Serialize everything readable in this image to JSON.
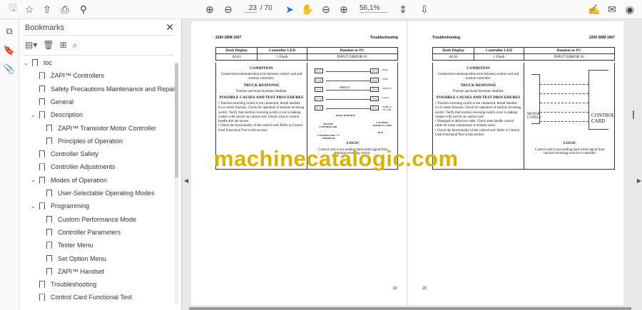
{
  "toolbar": {
    "page_current": "23",
    "page_total": "/ 70",
    "zoom": "56,1%"
  },
  "bookmarks": {
    "title": "Bookmarks",
    "items": [
      {
        "label": "toc",
        "level": 0,
        "twisty": "expanded"
      },
      {
        "label": "ZAPI™ Controllers",
        "level": 1
      },
      {
        "label": "Safety Precautions Maintenance and Repair",
        "level": 1
      },
      {
        "label": "General",
        "level": 1
      },
      {
        "label": "Description",
        "level": 1,
        "twisty": "expanded"
      },
      {
        "label": "ZAPI™ Transistor Motor Controller",
        "level": 2
      },
      {
        "label": "Principles of Operation",
        "level": 2
      },
      {
        "label": "Controller Safety",
        "level": 1
      },
      {
        "label": "Controller Adjustments",
        "level": 1
      },
      {
        "label": "Modes of Operation",
        "level": 1,
        "twisty": "expanded"
      },
      {
        "label": "User-Selectable Operating Modes",
        "level": 2
      },
      {
        "label": "Programming",
        "level": 1,
        "twisty": "expanded"
      },
      {
        "label": "Custom Performance Mode",
        "level": 2
      },
      {
        "label": "Controller Parameters",
        "level": 2
      },
      {
        "label": "Tester Menu",
        "level": 2
      },
      {
        "label": "Set Option Menu",
        "level": 2
      },
      {
        "label": "ZAPI™ Handset",
        "level": 2
      },
      {
        "label": "Troubleshooting",
        "level": 1
      },
      {
        "label": "Control Card Functional Test",
        "level": 1
      }
    ]
  },
  "pages": [
    {
      "header_left": "2200 SRM 1067",
      "header_right": "Troubleshooting",
      "col1": "Dash Display",
      "col2": "Controller LED",
      "col3": "Handset or PC",
      "val1": "AL01",
      "val2": "1 Flash",
      "val3": "INPUT ERROR #1",
      "condition_h": "CONDITION",
      "condition": "Connection/communication error between control card and traction controller.",
      "truck_h": "TRUCK RESPONSE",
      "truck": "Traction and hoist functions disabled.",
      "causes_h": "POSSIBLE CAUSES AND TEST PROCEDURES",
      "causes": [
        "• Traction reversing switch is not connected. Install handset. Go to tester function. Check for operation of traction reversing switch. Verify that traction reversing switch cover is making contact with switch on control card. Check wires in control handle arm are secure.",
        "• Check the functionality of the control card. Refer to Control Card Functional Test in this section."
      ],
      "logic_h": "LOGIC",
      "logic": "Control card is not sending hard-wired signal from traction-reversing switch.",
      "page_number": "19",
      "diagram": {
        "left_pins": [
          "C-7",
          "C-6",
          "C-5",
          "C-3",
          "C-2"
        ],
        "right_pins": [
          "A-1",
          "A-2",
          "A-3",
          "A-4",
          "A-5"
        ],
        "right_labels": [
          "PWR",
          "GND",
          "SELECT",
          "DATA",
          "ENBL & TILLER"
        ],
        "shield": "SHIELD",
        "harness": "MAIN HARNESS",
        "motor": "MOTOR CONTROLLER",
        "card": "CONTROL HANDLE CARD",
        "jp": "JP-01",
        "terminal": "CONTROLLER \"C\" TERMINAL"
      }
    },
    {
      "header_left": "Troubleshooting",
      "header_right": "2200 SRM 1067",
      "col1": "Dash Display",
      "col2": "Controller LED",
      "col3": "Handset or PC",
      "val1": "AL01",
      "val2": "1 Flash",
      "val3": "INPUT ERROR #2",
      "condition_h": "CONDITION",
      "condition": "Connection/communication error between control card and traction controller.",
      "truck_h": "TRUCK RESPONSE",
      "truck": "Traction and hoist functions disabled.",
      "causes_h": "POSSIBLE CAUSES AND TEST PROCEDURES",
      "causes": [
        "• Traction reversing switch is not connected. Install handset. Go to tester function. Check for operation of traction reversing switch. Verify that traction reversing switch cover is making contact with switch on control card.",
        "• Damaged or defective cable. Check steer handle control cable for loose connections or broken wires.",
        "• Check the functionality of the control card. Refer to Control Card Functional Test in this section."
      ],
      "logic_h": "LOGIC",
      "logic": "Control card is not sending hard-wired signal from traction-reversing switch to controller.",
      "page_number": "20",
      "diagram": {
        "motor": "MOTOR CNTRLR",
        "card": "CONTROL CARD"
      }
    }
  ],
  "watermark": "machinecatalogic.com"
}
